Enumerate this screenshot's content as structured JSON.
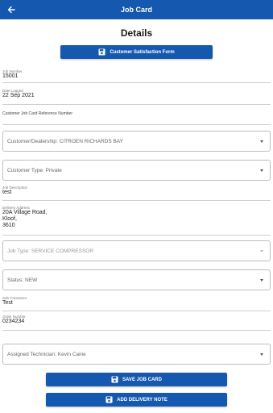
{
  "header": {
    "title": "Job Card"
  },
  "page": {
    "heading": "Details"
  },
  "buttons": {
    "csf": "Customer Satisfaction Form",
    "save": "SAVE JOB CARD",
    "delivery": "ADD DELIVERY NOTE"
  },
  "fields": {
    "job_number": {
      "label": "Job Number",
      "value": "15001"
    },
    "date_logged": {
      "label": "Date Logged",
      "value": "22 Sep 2021"
    },
    "customer_ref": {
      "label": "Customer Job Card Reference Number"
    },
    "job_description": {
      "label": "Job Description",
      "value": "test"
    },
    "delivery_address": {
      "label": "Delivery Address",
      "value": "20A Village Road,\nKloof,\n3610"
    },
    "sub_contractor": {
      "label": "Sub Contractor",
      "value": "Test"
    },
    "order_number": {
      "label": "Order Number",
      "value": "0234234"
    }
  },
  "dropdowns": {
    "customer": "Customer/Dealership:  CITROEN RICHARDS BAY",
    "customer_type": "Customer Type:  Private",
    "job_type": "Job Type:  SERVICE COMPRESSOR",
    "status": "Status:  NEW",
    "technician": "Assigned Technician:  Kevin Caine"
  },
  "colors": {
    "primary": "#1558b0"
  },
  "icons": {
    "back": "arrow-left-icon",
    "save": "floppy-disk-icon"
  }
}
